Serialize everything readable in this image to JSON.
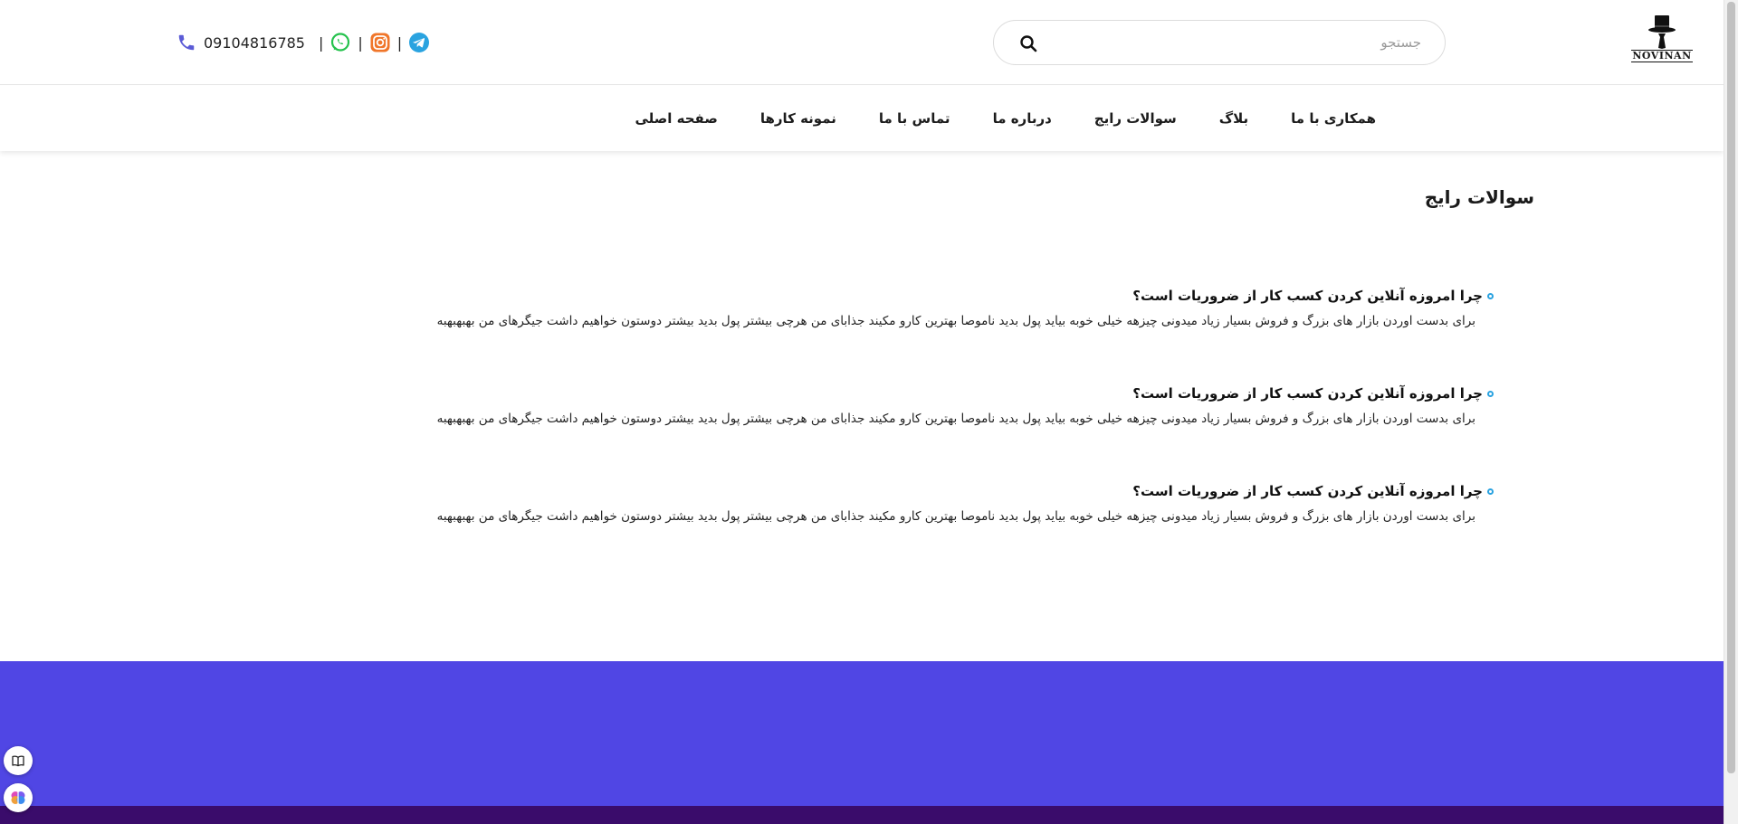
{
  "header": {
    "logo_text": "NOVINAN",
    "search_placeholder": "جستجو",
    "phone": "09104816785",
    "separator": "|",
    "social": [
      "whatsapp-icon",
      "instagram-icon",
      "telegram-icon"
    ]
  },
  "nav": {
    "items": [
      "صفحه اصلی",
      "نمونه کارها",
      "تماس با ما",
      "درباره ما",
      "سوالات رایج",
      "بلاگ",
      "همکاری با ما"
    ]
  },
  "faq": {
    "title": "سوالات رایج",
    "items": [
      {
        "question": "چرا امروزه آنلاین کردن کسب کار از ضروریات است؟",
        "answer": "برای بدست اوردن بازار های بزرگ و فروش بسیار زیاد میدونی چیزهه خیلی خوبه بیاید پول بدید ناموصا بهترین کارو مکیند جذابای من هرچی بیشتر پول بدید بیشتر دوستون خواهیم داشت جیگرهای من بهبهبهبه"
      },
      {
        "question": "چرا امروزه آنلاین کردن کسب کار از ضروریات است؟",
        "answer": "برای بدست اوردن بازار های بزرگ و فروش بسیار زیاد میدونی چیزهه خیلی خوبه بیاید پول بدید ناموصا بهترین کارو مکیند جذابای من هرچی بیشتر پول بدید بیشتر دوستون خواهیم داشت جیگرهای من بهبهبهبه"
      },
      {
        "question": "چرا امروزه آنلاین کردن کسب کار از ضروریات است؟",
        "answer": "برای بدست اوردن بازار های بزرگ و فروش بسیار زیاد میدونی چیزهه خیلی خوبه بیاید پول بدید ناموصا بهترین کارو مکیند جذابای من هرچی بیشتر پول بدید بیشتر دوستون خواهیم داشت جیگرهای من بهبهبهبه"
      }
    ]
  },
  "colors": {
    "footer": "#5046e4",
    "footer_bottom": "#3a0c6b",
    "bullet": "#2aa2e0",
    "phone_icon": "#5b5bd6"
  },
  "widgets": [
    "book-icon",
    "brain-icon"
  ]
}
